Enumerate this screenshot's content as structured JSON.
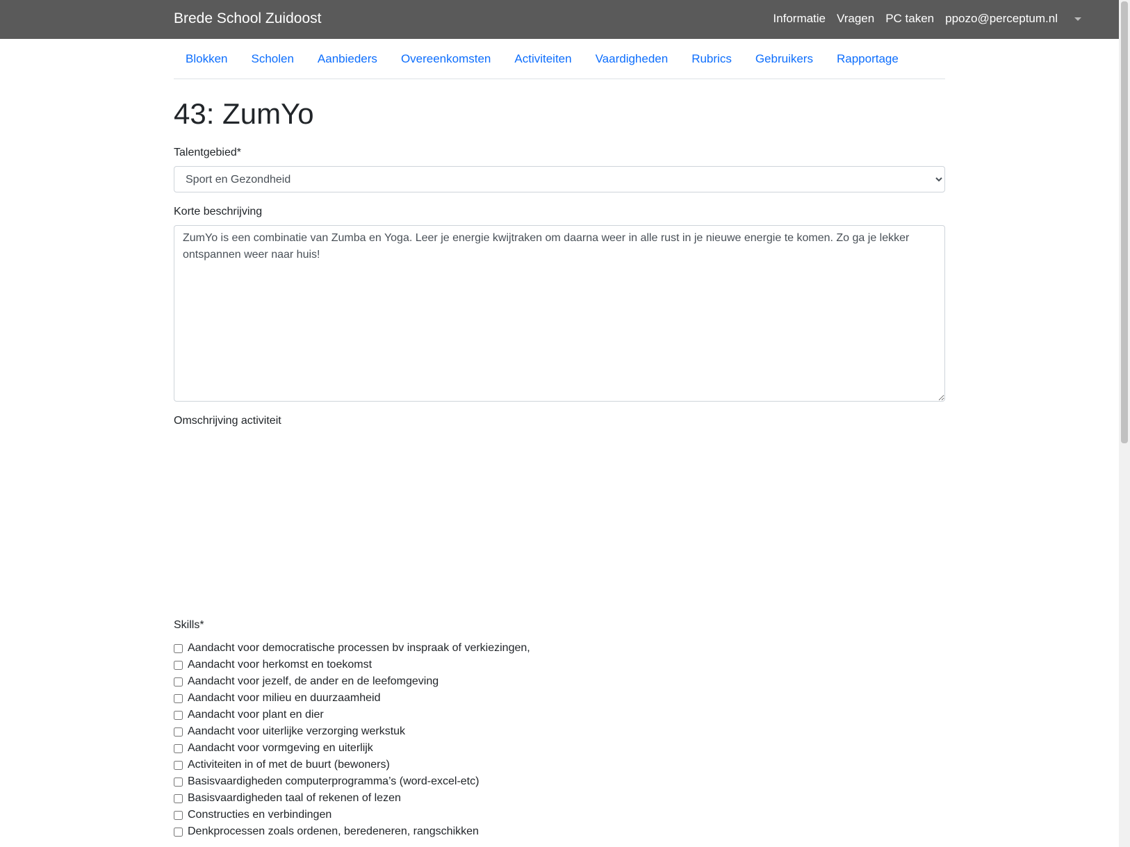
{
  "header": {
    "brand": "Brede School Zuidoost",
    "links": [
      "Informatie",
      "Vragen",
      "PC taken",
      "ppozo@perceptum.nl"
    ]
  },
  "subnav": {
    "items": [
      "Blokken",
      "Scholen",
      "Aanbieders",
      "Overeenkomsten",
      "Activiteiten",
      "Vaardigheden",
      "Rubrics",
      "Gebruikers",
      "Rapportage"
    ]
  },
  "page": {
    "title": "43: ZumYo"
  },
  "form": {
    "talentgebied_label": "Talentgebied*",
    "talentgebied_value": "Sport en Gezondheid",
    "korte_label": "Korte beschrijving",
    "korte_value": "ZumYo is een combinatie van Zumba en Yoga. Leer je energie kwijtraken om daarna weer in alle rust in je nieuwe energie te komen. Zo ga je lekker ontspannen weer naar huis!",
    "omschrijving_label": "Omschrijving activiteit",
    "skills_label": "Skills*",
    "skills": [
      "Aandacht voor democratische processen bv inspraak of verkiezingen,",
      "Aandacht voor herkomst en toekomst",
      "Aandacht voor jezelf, de ander en de leefomgeving",
      "Aandacht voor milieu en duurzaamheid",
      "Aandacht voor plant en dier",
      "Aandacht voor uiterlijke verzorging werkstuk",
      "Aandacht voor vormgeving en uiterlijk",
      "Activiteiten in of met de buurt (bewoners)",
      "Basisvaardigheden computerprogramma’s (word-excel-etc)",
      "Basisvaardigheden taal of rekenen of lezen",
      "Constructies en verbindingen",
      "Denkprocessen zoals ordenen, beredeneren, rangschikken"
    ]
  }
}
